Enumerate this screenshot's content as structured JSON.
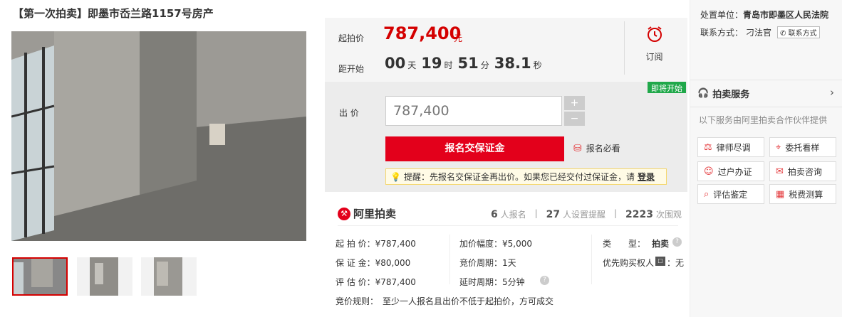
{
  "title": "【第一次拍卖】即墨市岙兰路1157号房产",
  "price": {
    "label": "起拍价",
    "value": "787,400",
    "unit": "元"
  },
  "countdown": {
    "label": "距开始",
    "d": "00",
    "d_unit": "天",
    "h": "19",
    "h_unit": "时",
    "m": "51",
    "m_unit": "分",
    "s": "38.1",
    "s_unit": "秒"
  },
  "subscribe_label": "订阅",
  "soon_badge": "即将开始",
  "bid": {
    "label": "出 价",
    "value": "787,400",
    "plus": "+",
    "minus": "−"
  },
  "deposit_button": "报名交保证金",
  "must_read": "报名必看",
  "tip": {
    "text": "提醒：先报名交保证金再出价。如果您已经交付过保证金，请",
    "link": "登录"
  },
  "brand": "阿里拍卖",
  "stats": [
    {
      "num": "6",
      "label": "人报名"
    },
    {
      "num": "27",
      "label": "人设置提醒"
    },
    {
      "num": "2223",
      "label": "次围观"
    }
  ],
  "details": {
    "start_price": "起 拍 价：¥787,400",
    "deposit": "保 证 金：¥80,000",
    "appraise": "评 估 价：¥787,400",
    "increment": "加价幅度：¥5,000",
    "period": "竞价周期：1天",
    "delay": "延时周期：5分钟",
    "type_label": "类　　型：",
    "type_value": "拍卖",
    "priority": "优先购买权人",
    "priority_value": "：无",
    "rule": "竞价规则：　至少一人报名且出价不低于起拍价，方可成交"
  },
  "sidebar": {
    "org_label": "处置单位：",
    "org_value": "青岛市即墨区人民法院",
    "contact_label": "联系方式：",
    "contact_name": "刁法官",
    "contact_button": "联系方式",
    "service_title": "拍卖服务",
    "service_desc": "以下服务由阿里拍卖合作伙伴提供",
    "services": [
      "律师尽调",
      "委托看样",
      "过户办证",
      "拍卖咨询",
      "评估鉴定",
      "税费测算"
    ]
  }
}
